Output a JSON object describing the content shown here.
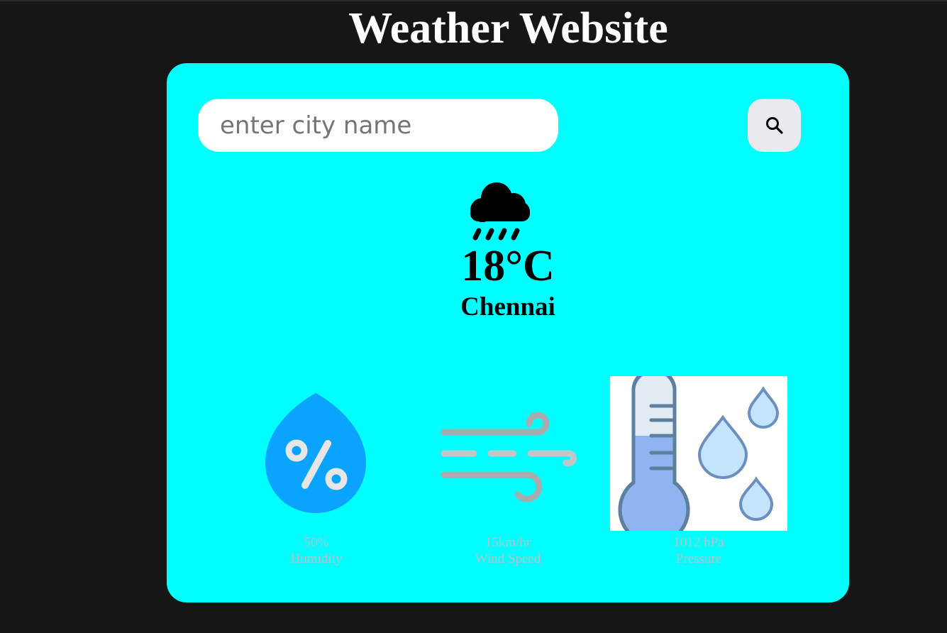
{
  "header": {
    "title": "Weather Website"
  },
  "search": {
    "placeholder": "enter city name",
    "value": ""
  },
  "current": {
    "temperature": "18°C",
    "city": "Chennai",
    "condition_icon": "cloud-moon-rain-icon"
  },
  "details": [
    {
      "value": "50%",
      "label": "Humidity",
      "icon": "humidity-icon"
    },
    {
      "value": "15km/hr",
      "label": "Wind Speed",
      "icon": "wind-icon"
    },
    {
      "value": "1012 hPa",
      "label": "Pressure",
      "icon": "pressure-icon"
    }
  ],
  "colors": {
    "background": "#161616",
    "card": "#00ffff",
    "title": "#ffffff",
    "search_button": "#e9e9ee",
    "detail_text": "#b0c4cc",
    "humidity_drop": "#0aa3ff"
  }
}
